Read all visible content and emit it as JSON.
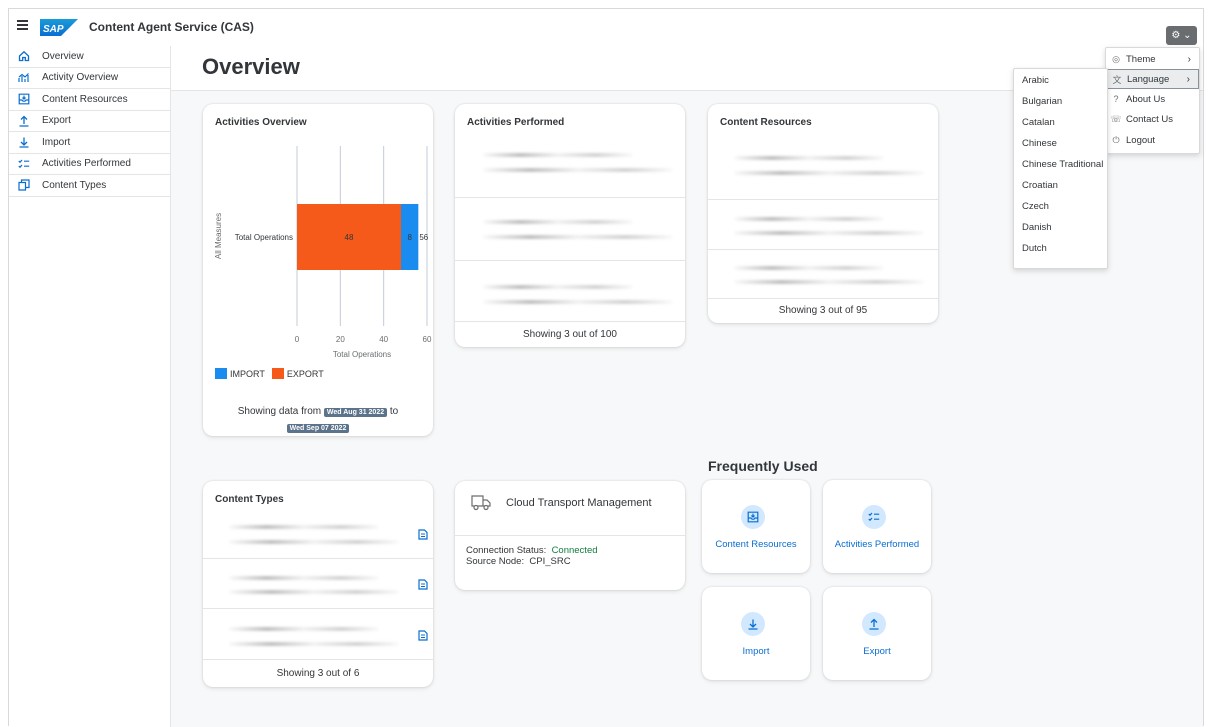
{
  "shell": {
    "app_title": "Content Agent Service (CAS)",
    "logo_text": "SAP"
  },
  "sidebar": {
    "items": [
      {
        "label": "Overview",
        "icon": "home-icon"
      },
      {
        "label": "Activity Overview",
        "icon": "line-chart-icon"
      },
      {
        "label": "Content Resources",
        "icon": "inbox-download-icon"
      },
      {
        "label": "Export",
        "icon": "upload-icon"
      },
      {
        "label": "Import",
        "icon": "download-icon"
      },
      {
        "label": "Activities Performed",
        "icon": "checklist-icon"
      },
      {
        "label": "Content Types",
        "icon": "copy-icon"
      }
    ]
  },
  "page": {
    "title": "Overview"
  },
  "activities_overview": {
    "title": "Activities Overview",
    "legend": [
      "IMPORT",
      "EXPORT"
    ],
    "date_prefix": "Showing data from",
    "date_from": "Wed Aug 31 2022",
    "date_to_word": "to",
    "date_to": "Wed Sep 07 2022"
  },
  "chart_data": {
    "type": "bar",
    "orientation": "horizontal",
    "stacked": true,
    "categories": [
      "Total Operations"
    ],
    "series": [
      {
        "name": "EXPORT",
        "values": [
          48
        ],
        "color": "#f55a1a"
      },
      {
        "name": "IMPORT",
        "values": [
          8
        ],
        "color": "#1a8cf0"
      }
    ],
    "totals": [
      56
    ],
    "xlabel": "Total Operations",
    "ylabel": "All Measures",
    "xlim": [
      0,
      60
    ],
    "xticks": [
      0,
      20,
      40,
      60
    ],
    "grid": true,
    "legend_position": "bottom-left"
  },
  "activities_performed": {
    "title": "Activities Performed",
    "footer": "Showing 3 out of 100"
  },
  "content_resources": {
    "title": "Content Resources",
    "footer": "Showing 3 out of 95"
  },
  "content_types": {
    "title": "Content Types",
    "footer": "Showing 3 out of 6"
  },
  "ctm": {
    "title": "Cloud Transport Management",
    "status_label": "Connection Status:",
    "status_value": "Connected",
    "status_color": "#107e3e",
    "node_label": "Source Node:",
    "node_value": "CPI_SRC"
  },
  "frequently_used": {
    "title": "Frequently Used",
    "tiles": [
      {
        "label": "Content Resources",
        "icon": "inbox-download-icon"
      },
      {
        "label": "Activities Performed",
        "icon": "checklist-icon"
      },
      {
        "label": "Import",
        "icon": "download-icon"
      },
      {
        "label": "Export",
        "icon": "upload-icon"
      }
    ]
  },
  "settings_menu": {
    "items": [
      {
        "label": "Theme",
        "icon": "palette-icon"
      },
      {
        "label": "Language",
        "icon": "language-icon"
      },
      {
        "label": "About Us",
        "icon": "question-icon"
      },
      {
        "label": "Contact Us",
        "icon": "contact-icon"
      },
      {
        "label": "Logout",
        "icon": "power-icon"
      }
    ]
  },
  "language_menu": {
    "items": [
      "Arabic",
      "Bulgarian",
      "Catalan",
      "Chinese",
      "Chinese Traditional",
      "Croatian",
      "Czech",
      "Danish",
      "Dutch"
    ]
  },
  "colors": {
    "accent": "#0a6ed1",
    "export": "#f55a1a",
    "import": "#1a8cf0",
    "pill": "#5b738b"
  }
}
